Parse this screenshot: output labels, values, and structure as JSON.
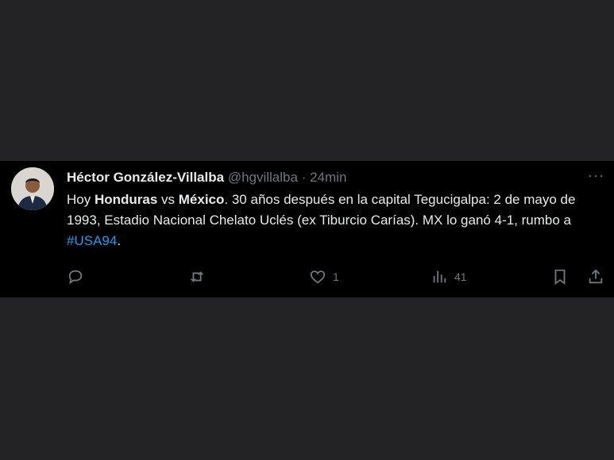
{
  "tweet": {
    "author_name": "Héctor González-Villalba",
    "handle": "@hgvillalba",
    "separator": "·",
    "time": "24min",
    "more": "···",
    "text": {
      "t1": "Hoy ",
      "b1": "Honduras",
      "t2": " vs ",
      "b2": "México",
      "t3": ". 30 años después en la capital Tegucigalpa: 2 de mayo de 1993, Estadio Nacional Chelato Uclés (ex Tiburcio Carías). MX lo ganó 4-1, rumbo a ",
      "hashtag": "#USA94",
      "t4": "."
    },
    "actions": {
      "reply_icon": "reply-icon",
      "retweet_icon": "retweet-icon",
      "like_icon": "heart-icon",
      "like_count": "1",
      "views_icon": "views-icon",
      "views_count": "41",
      "bookmark_icon": "bookmark-icon",
      "share_icon": "share-icon"
    }
  },
  "colors": {
    "background": "#232325",
    "tweet_bg": "#000000",
    "text": "#e7e9ea",
    "muted": "#71767b",
    "link": "#1d9bf0"
  }
}
